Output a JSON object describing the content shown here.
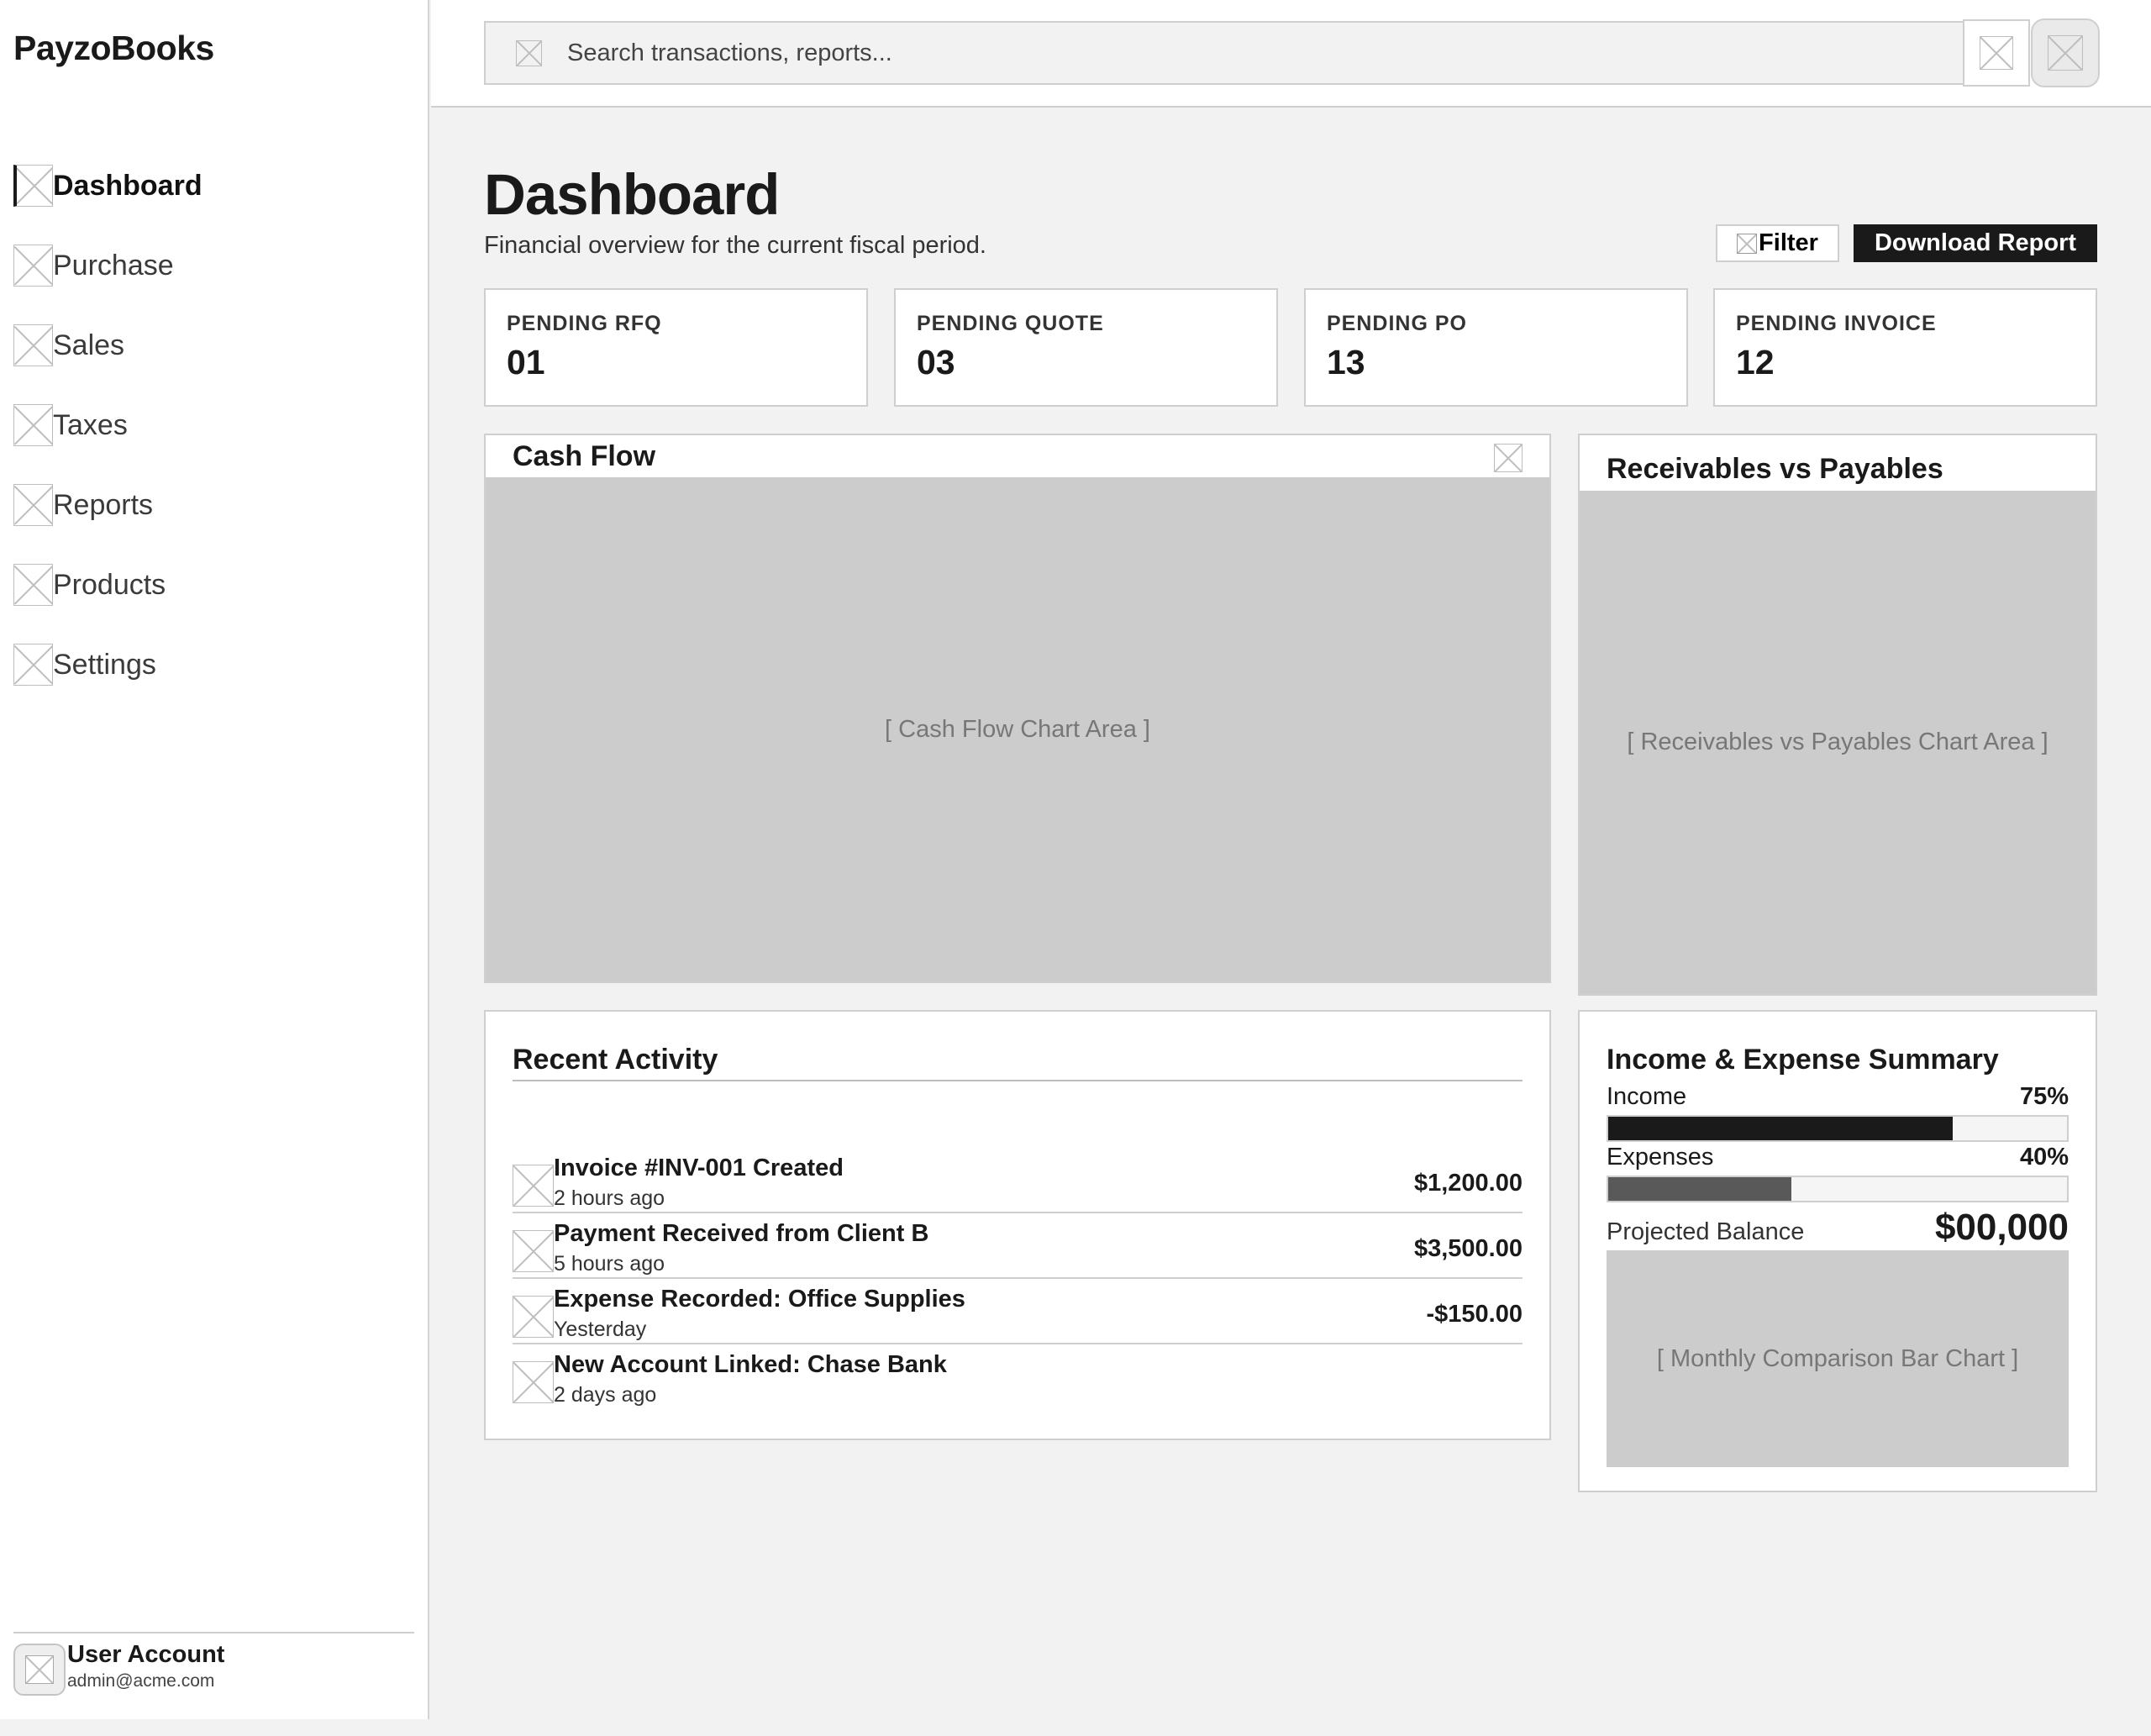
{
  "app": {
    "brand": "PayzoBooks"
  },
  "sidebar": {
    "items": [
      {
        "label": "Dashboard",
        "icon": "dashboard-icon",
        "active": true
      },
      {
        "label": "Purchase",
        "icon": "purchase-icon"
      },
      {
        "label": "Sales",
        "icon": "sales-icon"
      },
      {
        "label": "Taxes",
        "icon": "taxes-icon"
      },
      {
        "label": "Reports",
        "icon": "reports-icon"
      },
      {
        "label": "Products",
        "icon": "products-icon"
      },
      {
        "label": "Settings",
        "icon": "settings-icon"
      }
    ],
    "account": {
      "name": "User Account",
      "email": "admin@acme.com"
    }
  },
  "topbar": {
    "search_placeholder": "Search transactions, reports...",
    "icons": [
      "search-icon",
      "notifications-icon",
      "profile-icon"
    ]
  },
  "header": {
    "title": "Dashboard",
    "subtitle": "Financial overview for the current fiscal period.",
    "filter_label": "Filter",
    "download_label": "Download Report"
  },
  "stats": [
    {
      "label": "PENDING RFQ",
      "value": "01"
    },
    {
      "label": "PENDING QUOTE",
      "value": "03"
    },
    {
      "label": "PENDING PO",
      "value": "13"
    },
    {
      "label": "PENDING INVOICE",
      "value": "12"
    }
  ],
  "cash_flow": {
    "title": "Cash Flow",
    "placeholder": "[ Cash Flow Chart Area ]"
  },
  "receivables": {
    "title": "Receivables vs Payables",
    "placeholder": "[ Receivables vs Payables Chart Area ]"
  },
  "recent": {
    "title": "Recent Activity",
    "items": [
      {
        "title": "Invoice #INV-001 Created",
        "time": "2 hours ago",
        "amount": "$1,200.00"
      },
      {
        "title": "Payment Received from Client B",
        "time": "5 hours ago",
        "amount": "$3,500.00"
      },
      {
        "title": "Expense Recorded: Office Supplies",
        "time": "Yesterday",
        "amount": "-$150.00"
      },
      {
        "title": "New Account Linked: Chase Bank",
        "time": "2 days ago",
        "amount": ""
      }
    ]
  },
  "summary": {
    "title": "Income & Expense Summary",
    "income": {
      "label": "Income",
      "percent_label": "75%",
      "fraction": 0.75,
      "color": "#1a1a1a"
    },
    "expenses": {
      "label": "Expenses",
      "percent_label": "40%",
      "fraction": 0.4,
      "color": "#595959"
    },
    "projected_label": "Projected Balance",
    "projected_value": "$00,000",
    "placeholder": "[ Monthly Comparison Bar Chart ]"
  }
}
